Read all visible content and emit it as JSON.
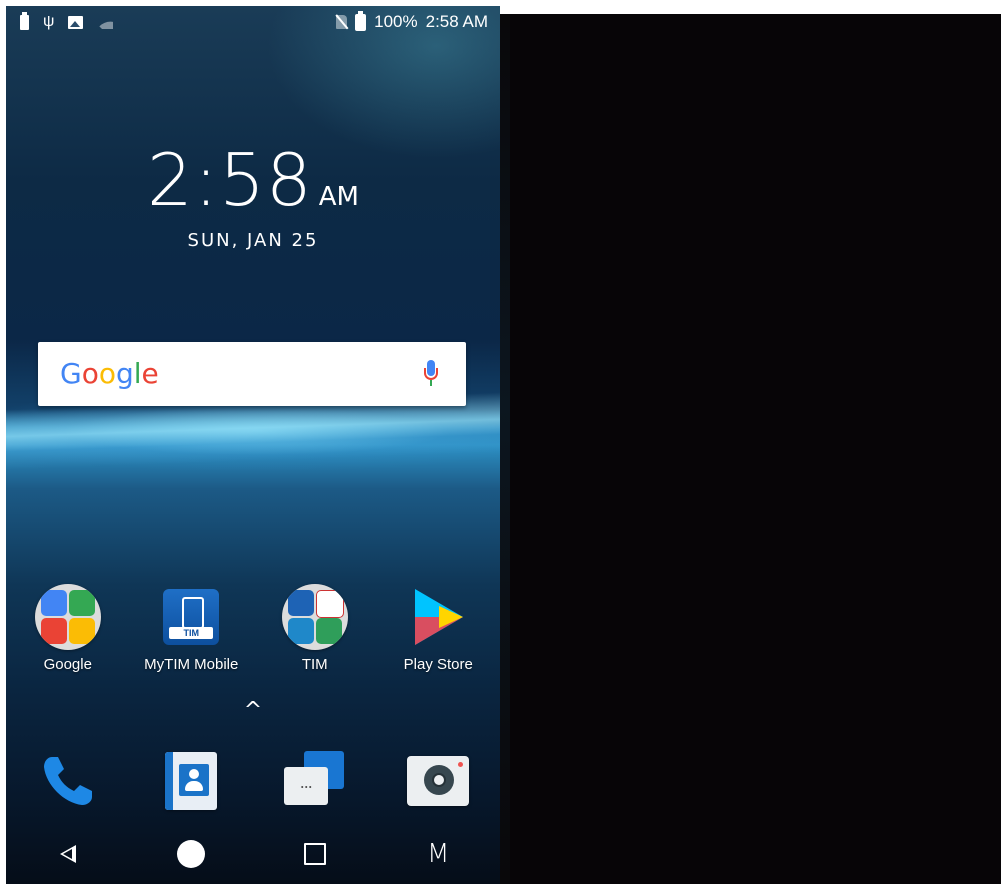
{
  "status_bar": {
    "battery_percent": "100%",
    "time": "2:58 AM"
  },
  "clock_widget": {
    "time": "2:58",
    "ampm": "AM",
    "date": "SUN, JAN 25"
  },
  "search": {
    "logo": "Google"
  },
  "apps": [
    {
      "label": "Google"
    },
    {
      "label": "MyTIM Mobile",
      "badge": "TIM"
    },
    {
      "label": "TIM"
    },
    {
      "label": "Play Store"
    }
  ],
  "dock": {
    "items": [
      "phone",
      "contacts",
      "messages",
      "camera"
    ],
    "messages_glyph": "..."
  },
  "nav": {
    "menu_label": "M",
    "caret": "^"
  },
  "colors": {
    "google_blue": "#4285F4",
    "google_red": "#EA4335",
    "google_yellow": "#FBBC05",
    "google_green": "#34A853",
    "right_panel": "#070507"
  }
}
